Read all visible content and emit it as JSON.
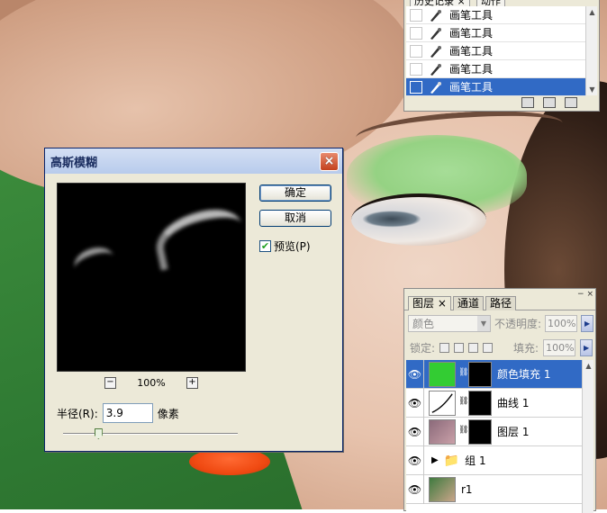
{
  "history_panel": {
    "tabs": [
      "历史记录",
      "动作"
    ],
    "items": [
      "画笔工具",
      "画笔工具",
      "画笔工具",
      "画笔工具",
      "画笔工具"
    ],
    "selected_index": 4
  },
  "dialog": {
    "title": "高斯模糊",
    "ok_label": "确定",
    "cancel_label": "取消",
    "preview_label": "预览(P)",
    "preview_checked": true,
    "zoom_value": "100%",
    "radius_label": "半径(R):",
    "radius_value": "3.9",
    "radius_unit": "像素",
    "slider_fraction": 0.2
  },
  "layers_panel": {
    "tabs": [
      "图层",
      "通道",
      "路径"
    ],
    "blend_mode": "颜色",
    "opacity_label": "不透明度:",
    "opacity_value": "100%",
    "lock_label": "锁定:",
    "fill_label": "填充:",
    "fill_value": "100%",
    "layers": [
      {
        "name": "颜色填充 1",
        "selected": true,
        "thumb_color": "#33cc33"
      },
      {
        "name": "曲线 1",
        "selected": false
      },
      {
        "name": "图层 1",
        "selected": false
      },
      {
        "name": "组 1",
        "selected": false
      },
      {
        "name": "r1",
        "selected": false
      }
    ]
  }
}
